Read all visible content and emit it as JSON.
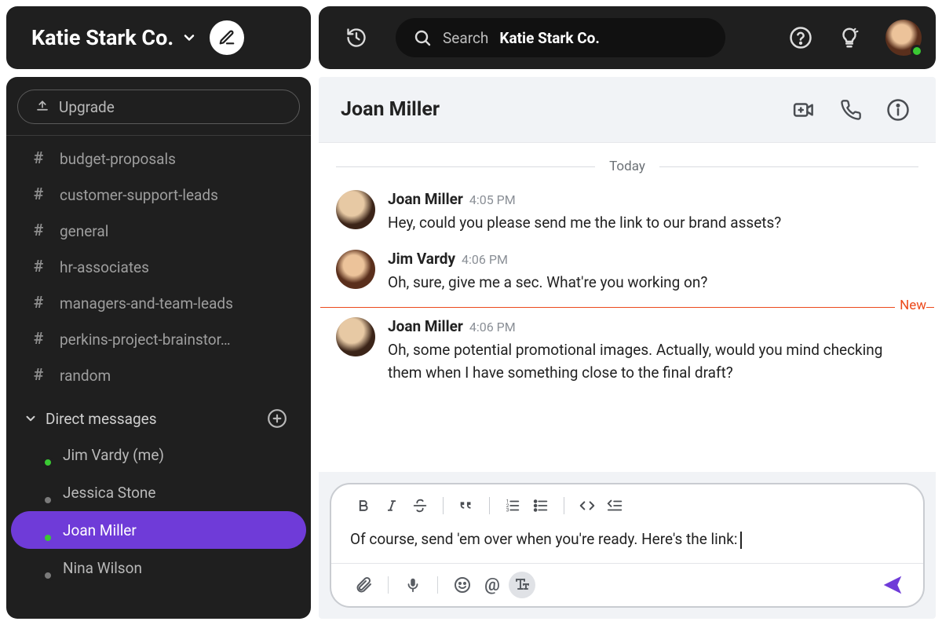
{
  "workspace": {
    "name": "Katie Stark Co."
  },
  "sidebar": {
    "upgrade_label": "Upgrade",
    "channels": [
      {
        "name": "budget-proposals"
      },
      {
        "name": "customer-support-leads"
      },
      {
        "name": "general"
      },
      {
        "name": "hr-associates"
      },
      {
        "name": "managers-and-team-leads"
      },
      {
        "name": "perkins-project-brainstor…"
      },
      {
        "name": "random"
      }
    ],
    "dm_header": "Direct messages",
    "dms": [
      {
        "name": "Jim Vardy (me)",
        "avatar": "av-jim",
        "presence": "online",
        "active": false
      },
      {
        "name": "Jessica Stone",
        "avatar": "av-jessica",
        "presence": "offline",
        "active": false
      },
      {
        "name": "Joan Miller",
        "avatar": "av-joan",
        "presence": "online",
        "active": true
      },
      {
        "name": "Nina Wilson",
        "avatar": "av-nina",
        "presence": "offline",
        "active": false
      }
    ]
  },
  "search": {
    "prefix": "Search",
    "context": "Katie Stark Co."
  },
  "chat": {
    "title": "Joan Miller",
    "date_label": "Today",
    "new_label": "New",
    "messages": [
      {
        "author": "Joan Miller",
        "time": "4:05 PM",
        "avatar": "av-joan",
        "body": "Hey, could you please send me the link to our brand assets?"
      },
      {
        "author": "Jim Vardy",
        "time": "4:06 PM",
        "avatar": "av-jim",
        "body": "Oh, sure, give me a sec. What're you working on?"
      },
      {
        "author": "Joan Miller",
        "time": "4:06 PM",
        "avatar": "av-joan",
        "body": "Oh, some potential promotional images. Actually, would you mind checking them when I have something close to the final draft?"
      }
    ],
    "new_after_index": 1
  },
  "composer": {
    "text": "Of course, send 'em over when you're ready. Here's the link:"
  },
  "icons": {
    "at": "@"
  }
}
